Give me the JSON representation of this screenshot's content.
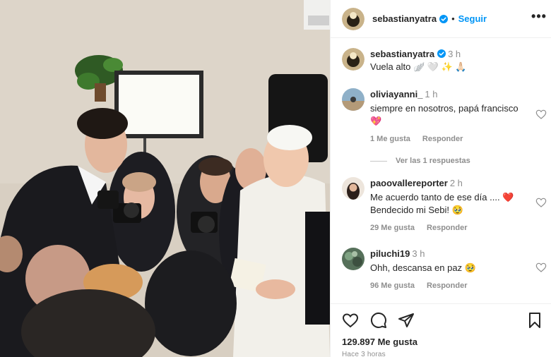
{
  "post": {
    "author": "sebastianyatra",
    "follow_label": "Seguir",
    "separator": "•",
    "more_label": "•••",
    "caption": {
      "user": "sebastianyatra",
      "time": "3 h",
      "text": "Vuela alto 🪽 🤍 ✨ 🙏🏻"
    }
  },
  "comments": [
    {
      "user": "oliviayanni_",
      "time": "1 h",
      "text": "siempre en nosotros, papá francisco 💖",
      "likes": "1 Me gusta",
      "reply": "Responder"
    },
    {
      "user": "paoovallereporter",
      "time": "2 h",
      "text": "Me acuerdo tanto de ese día .... ❤️ Bendecido mi Sebi! 🥹",
      "likes": "29 Me gusta",
      "reply": "Responder"
    },
    {
      "user": "piluchi19",
      "time": "3 h",
      "text": "Ohh, descansa en paz 🥹",
      "likes": "96 Me gusta",
      "reply": "Responder"
    }
  ],
  "view_replies": "Ver las 1 respuestas",
  "footer": {
    "likes": "129.897 Me gusta",
    "posted": "Hace 3 horas"
  },
  "icons": {
    "like": "heart-icon",
    "comment": "comment-icon",
    "share": "paper-plane-icon",
    "save": "bookmark-icon"
  },
  "colors": {
    "accent": "#0095f6",
    "verified": "#0095f6",
    "text": "#262626",
    "muted": "#8e8e8e"
  }
}
